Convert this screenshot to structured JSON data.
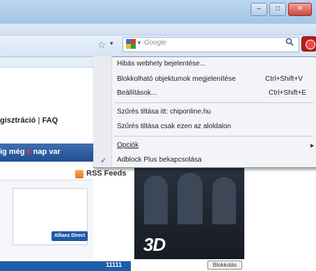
{
  "window": {
    "controls": {
      "minimize": "–",
      "maximize": "□",
      "close": "✕"
    }
  },
  "toolbar": {
    "star_icon": "star-icon",
    "search": {
      "placeholder": "Google",
      "go_icon": "search-icon"
    },
    "addon_icon": "adblock-plus-icon"
  },
  "page": {
    "nav_links": [
      "gisztráció",
      "FAQ"
    ],
    "nav_separator": "|",
    "banner": {
      "prefix": "ig még",
      "number": "8",
      "suffix": "nap var"
    },
    "rss_label": "RSS Feeds",
    "ad_button": "Allianz Direct",
    "bottom_number": "11111",
    "video_logo": "3D",
    "block_tag": "Blokkolás"
  },
  "context_menu": {
    "items": [
      {
        "label": "Hibás webhely bejelentése...",
        "shortcut": ""
      },
      {
        "label": "Blokkolható objektumok megjelenítése",
        "shortcut": "Ctrl+Shift+V"
      },
      {
        "label": "Beállítások...",
        "shortcut": "Ctrl+Shift+E"
      },
      {
        "label": "Szűrés tiltása itt: chiponline.hu",
        "shortcut": ""
      },
      {
        "label": "Szűrés tiltása csak ezen az aloldalon",
        "shortcut": ""
      },
      {
        "label": "Opciók",
        "shortcut": ""
      },
      {
        "label": "Adblock Plus bekapcsolása",
        "shortcut": ""
      }
    ],
    "checked_item": "Adblock Plus bekapcsolása",
    "check_mark": "✓",
    "submenu_arrow": "▶"
  },
  "colors": {
    "accent": "#2a52a8",
    "banner": "#1f4f91",
    "abp_red": "#b81c1c"
  }
}
